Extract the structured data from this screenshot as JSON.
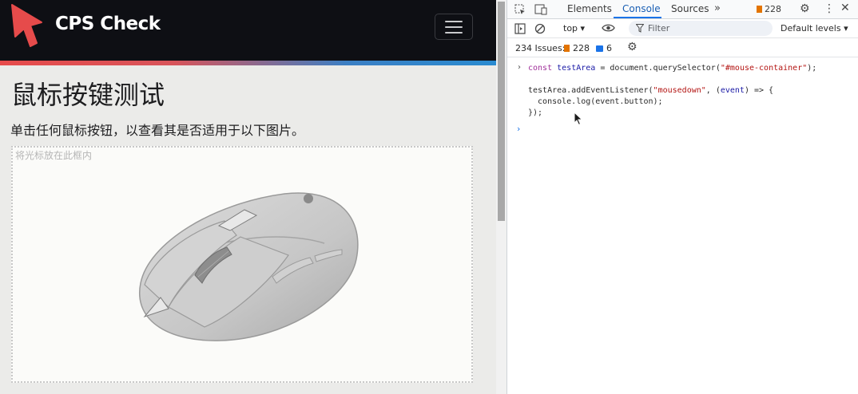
{
  "page": {
    "brand": "CPS Check",
    "title": "鼠标按键测试",
    "description": "单击任何鼠标按钮，以查看其是否适用于以下图片。",
    "area_hint": "将光标放在此框内"
  },
  "devtools": {
    "tabs": [
      "Elements",
      "Console",
      "Sources"
    ],
    "active_tab": "Console",
    "issue_badge": "228",
    "context": "top ▾",
    "filter_placeholder": "Filter",
    "levels": "Default levels ▾",
    "issues_label": "234 Issues:",
    "issues_warnings": "228",
    "issues_messages": "6",
    "code": {
      "line1_const": "const",
      "line1_name": "testArea",
      "line1_rest": " = document.querySelector(",
      "line1_str": "\"#mouse-container\"",
      "line1_end": ");",
      "line2_a": "testArea.addEventListener(",
      "line2_str": "\"mousedown\"",
      "line2_b": ", (",
      "line2_param": "event",
      "line2_c": ") => {",
      "line3": "  console.log(event.button);",
      "line4": "});"
    }
  },
  "colors": {
    "navbar": "#0e0f14",
    "accent_red": "#e64b4b",
    "accent_blue": "#2a8bd0",
    "devtools_active": "#1a73e8"
  }
}
